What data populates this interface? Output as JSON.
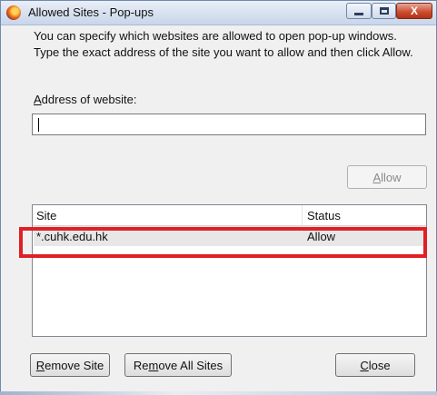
{
  "window": {
    "title": "Allowed Sites - Pop-ups",
    "close_glyph": "X",
    "accent_close": "#c94b2c",
    "frame_color": "#6f8ab0"
  },
  "dialog": {
    "description": "You can specify which websites are allowed to open pop-up windows. Type the exact address of the site you want to allow and then click Allow.",
    "address_label_prefix": "",
    "address_label_mnemonic": "A",
    "address_label_rest": "ddress of website:",
    "address_value": "",
    "allow_label_mnemonic": "A",
    "allow_label_rest": "llow"
  },
  "list": {
    "columns": [
      "Site",
      "Status"
    ],
    "rows": [
      {
        "site": "*.cuhk.edu.hk",
        "status": "Allow"
      }
    ],
    "highlight_color": "#e01f26"
  },
  "buttons": {
    "remove_site_mnemonic": "R",
    "remove_site_rest": "emove Site",
    "remove_all_prefix": "Re",
    "remove_all_mnemonic": "m",
    "remove_all_rest": "ove All Sites",
    "close_mnemonic": "C",
    "close_rest": "lose"
  },
  "icons": {
    "app": "firefox-icon",
    "minimize": "minimize-icon",
    "maximize": "maximize-icon",
    "close": "close-icon"
  }
}
